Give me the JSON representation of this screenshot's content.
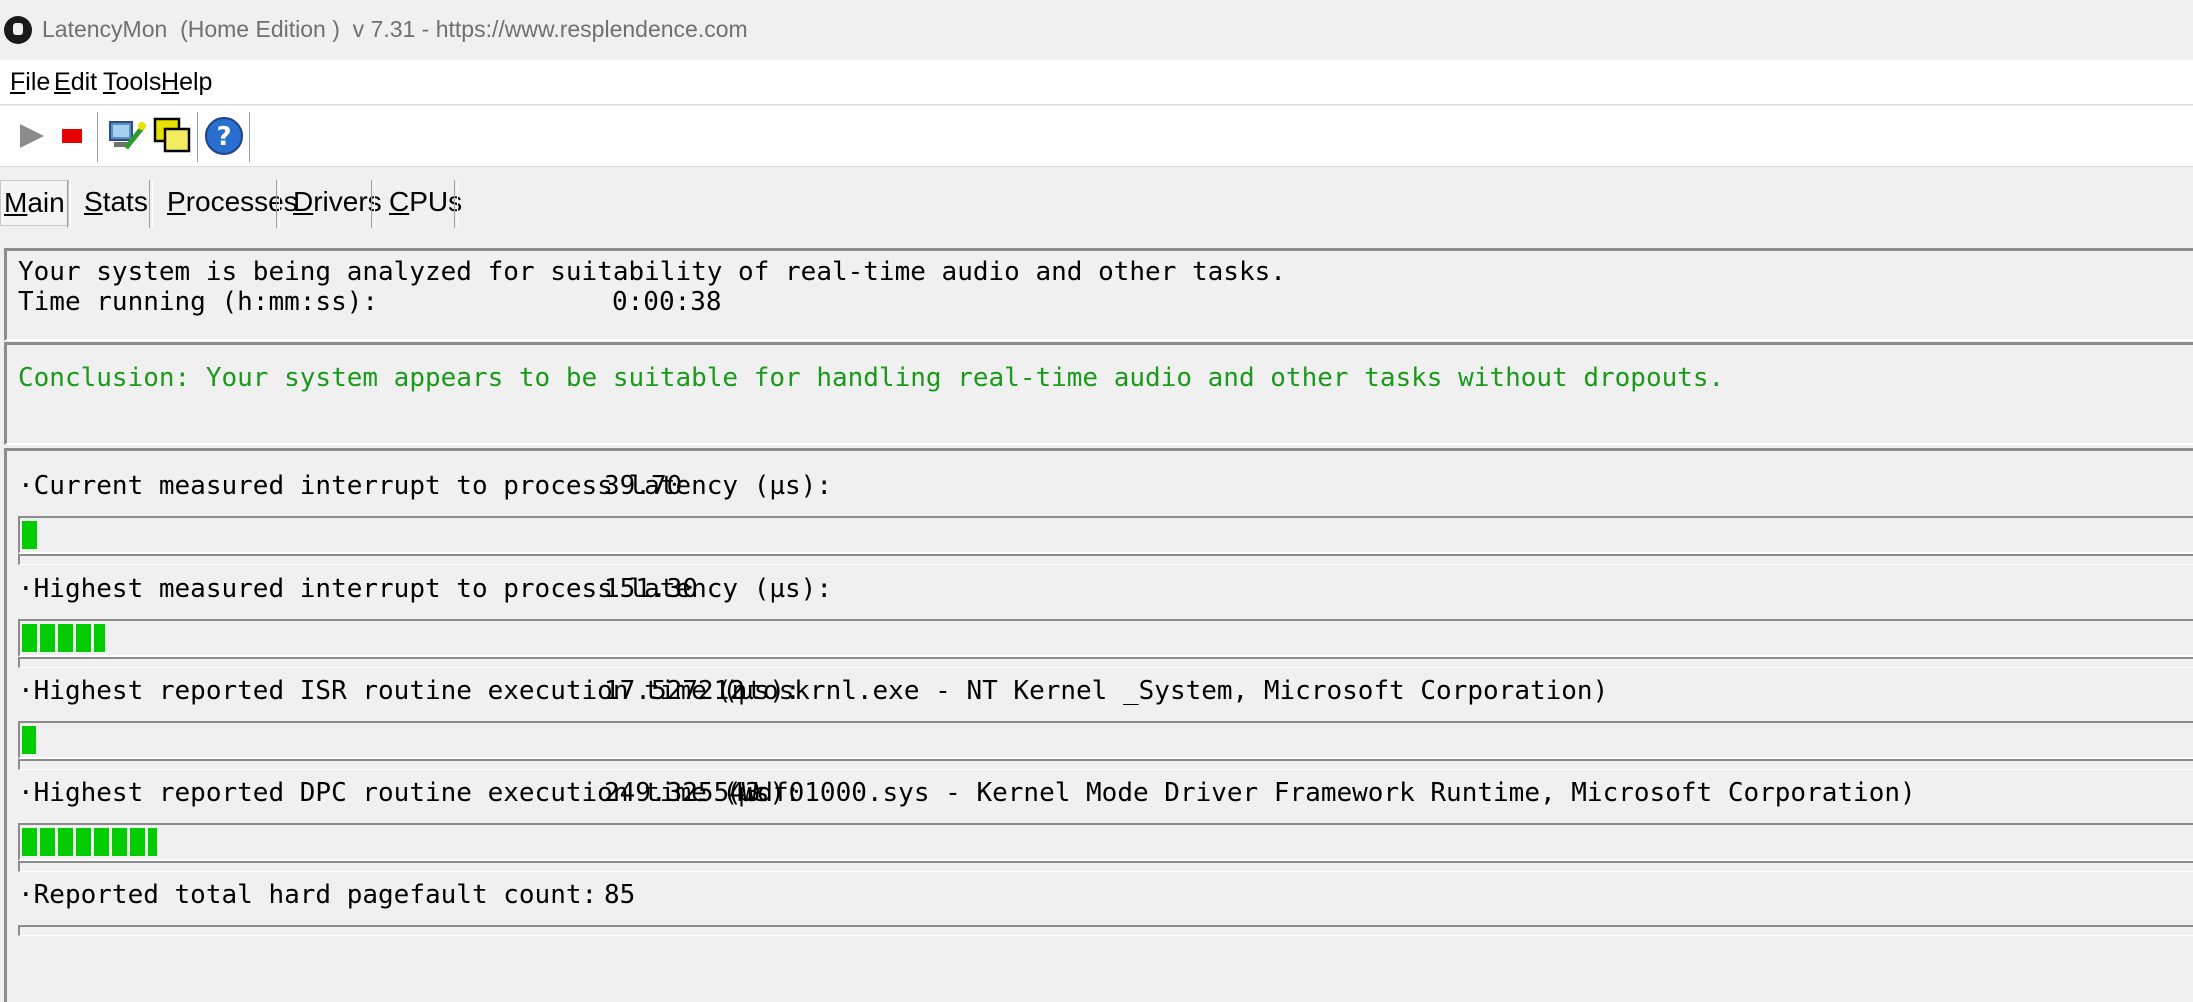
{
  "window": {
    "title": "LatencyMon  (Home Edition )  v 7.31 - https://www.resplendence.com"
  },
  "menu": {
    "file": "File",
    "edit": "Edit",
    "tools": "Tools",
    "help": "Help"
  },
  "toolbar": {
    "icons": [
      "play-icon",
      "stop-icon",
      "computer-wand-icon",
      "windows-icon",
      "help-icon"
    ]
  },
  "tabs": {
    "main": "Main",
    "stats": "Stats",
    "processes": "Processes",
    "drivers": "Drivers",
    "cpus": "CPUs",
    "active": "Main"
  },
  "status": {
    "analyzing": "Your system is being analyzed for suitability of real-time audio and other tasks.",
    "time_label": "Time running (h:mm:ss):",
    "time_value": "0:00:38"
  },
  "conclusion": {
    "text": "Conclusion: Your system appears to be suitable for handling real-time audio and other tasks without dropouts.",
    "color": "#1a9a1a"
  },
  "metrics": [
    {
      "label": "·Current measured interrupt to process latency (µs):",
      "value": "39.70",
      "detail": "",
      "progress_fraction": 0.008
    },
    {
      "label": "·Highest measured interrupt to process latency (µs):",
      "value": "151.30",
      "detail": "",
      "progress_fraction": 0.038
    },
    {
      "label": "·Highest reported ISR routine execution time (µs):",
      "value": "17.527212",
      "detail": "(ntoskrnl.exe - NT Kernel _System, Microsoft Corporation)",
      "progress_fraction": 0.006
    },
    {
      "label": "·Highest reported DPC routine execution time (µs):",
      "value": "249.325543",
      "detail": "(Wdf01000.sys - Kernel Mode Driver Framework Runtime, Microsoft Corporation)",
      "progress_fraction": 0.062
    },
    {
      "label": "·Reported total hard pagefault count:",
      "value": "85",
      "detail": ""
    }
  ],
  "colors": {
    "progress_green": "#00cc00",
    "background": "#f0f0f0"
  }
}
